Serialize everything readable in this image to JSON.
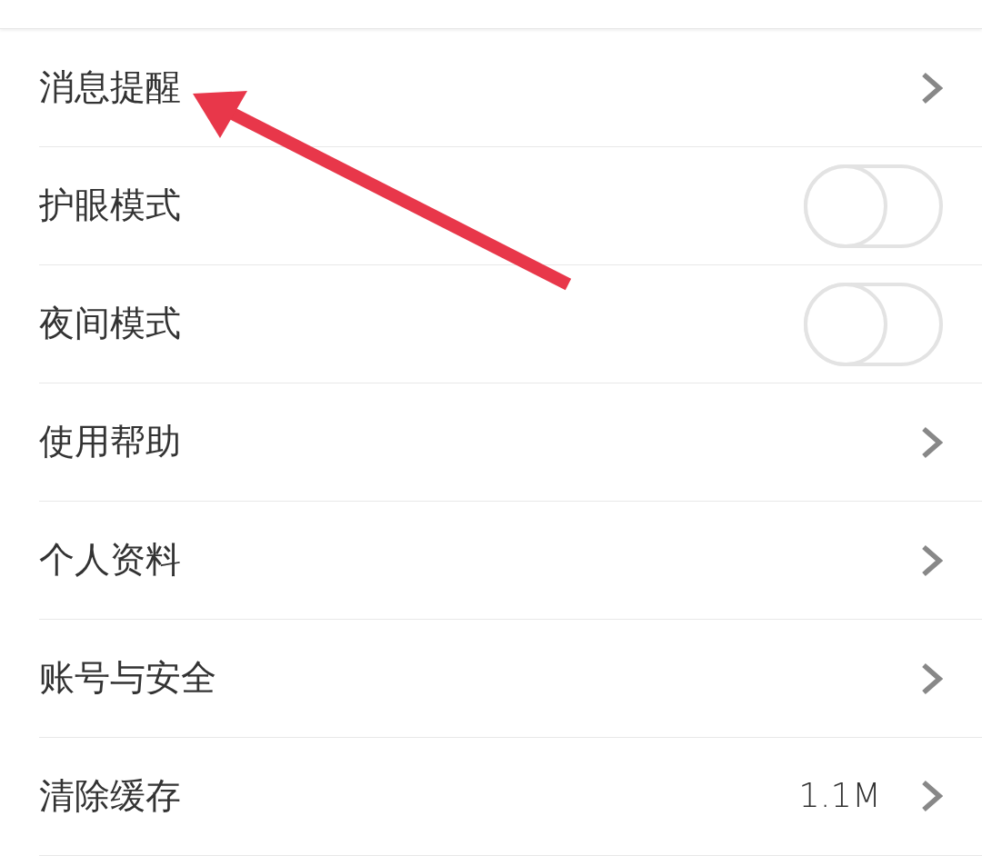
{
  "settings": [
    {
      "label": "消息提醒",
      "kind": "link"
    },
    {
      "label": "护眼模式",
      "kind": "toggle",
      "on": false
    },
    {
      "label": "夜间模式",
      "kind": "toggle",
      "on": false
    },
    {
      "label": "使用帮助",
      "kind": "link"
    },
    {
      "label": "个人资料",
      "kind": "link"
    },
    {
      "label": "账号与安全",
      "kind": "link"
    },
    {
      "label": "清除缓存",
      "kind": "link",
      "value": "1.1M"
    }
  ],
  "annotations": [
    {
      "kind": "arrow"
    }
  ]
}
